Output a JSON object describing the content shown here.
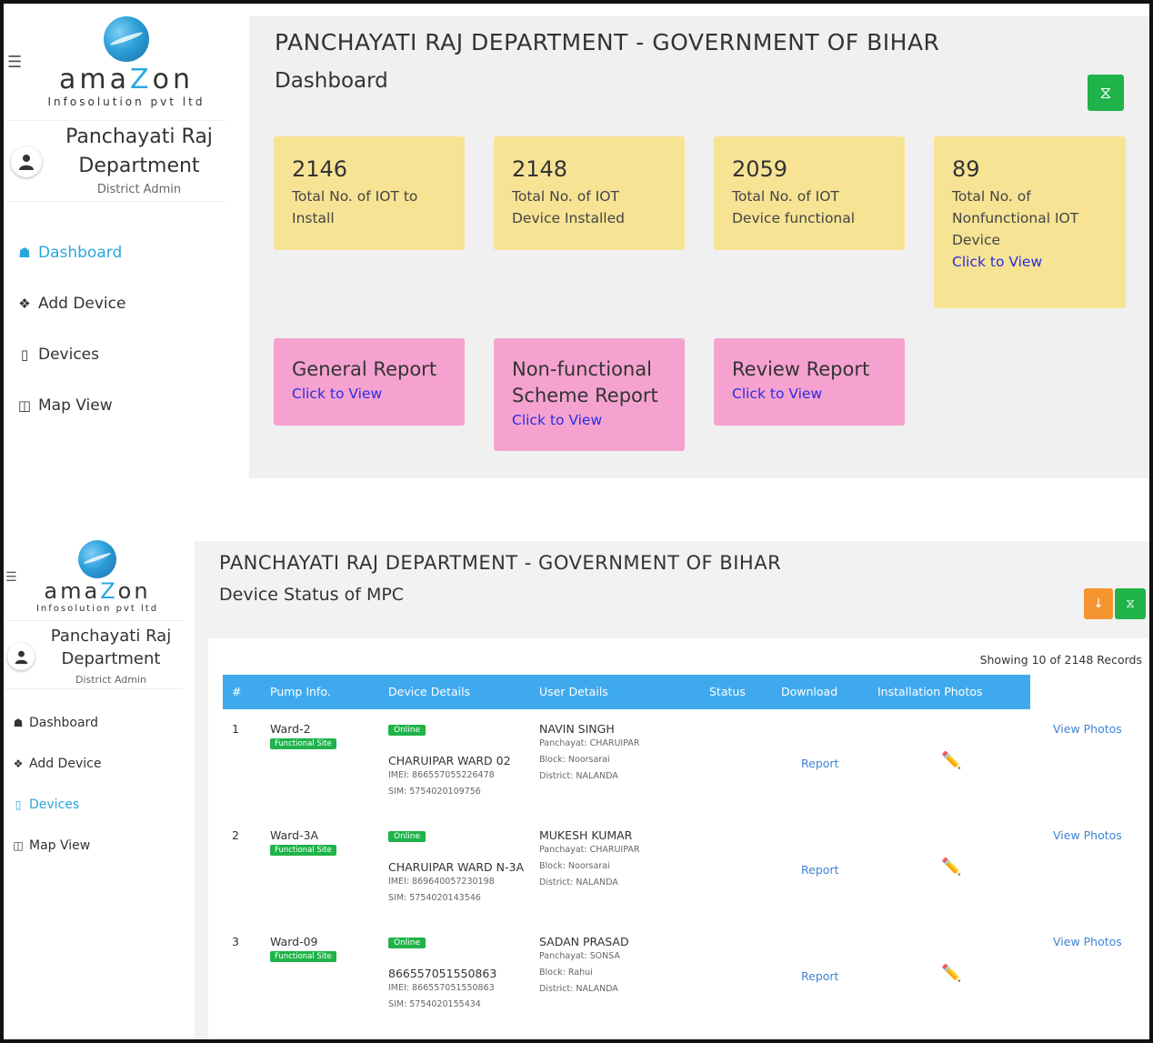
{
  "panel_a": {
    "logo": {
      "brand_left": "ama",
      "brand_z": "Z",
      "brand_right": "on",
      "tagline": "Infosolution pvt ltd"
    },
    "user": {
      "name_line1": "Panchayati Raj",
      "name_line2": "Department",
      "role": "District Admin"
    },
    "nav": [
      {
        "label": "Dashboard",
        "icon": "home-icon",
        "active": true
      },
      {
        "label": "Add Device",
        "icon": "grid-add-icon",
        "active": false
      },
      {
        "label": "Devices",
        "icon": "device-icon",
        "active": false
      },
      {
        "label": "Map View",
        "icon": "map-icon",
        "active": false
      }
    ],
    "header": {
      "title": "PANCHAYATI RAJ DEPARTMENT - GOVERNMENT OF BIHAR",
      "subtitle": "Dashboard"
    },
    "stat_cards": [
      {
        "value": "2146",
        "line1": "Total No. of IOT to",
        "line2": "Install"
      },
      {
        "value": "2148",
        "line1": "Total No. of IOT",
        "line2": "Device Installed"
      },
      {
        "value": "2059",
        "line1": "Total No. of IOT",
        "line2": "Device functional"
      },
      {
        "value": "89",
        "line1": "Total No. of",
        "line2": "Nonfunctional IOT",
        "line3": "Device",
        "link": "Click to View"
      }
    ],
    "report_cards": [
      {
        "title_line1": "General Report",
        "link": "Click to View"
      },
      {
        "title_line1": "Non-functional",
        "title_line2": "Scheme Report",
        "link": "Click to View"
      },
      {
        "title_line1": "Review Report",
        "link": "Click to View"
      }
    ]
  },
  "panel_b": {
    "logo": {
      "brand_left": "ama",
      "brand_z": "Z",
      "brand_right": "on",
      "tagline": "Infosolution pvt ltd"
    },
    "user": {
      "name_line1": "Panchayati Raj",
      "name_line2": "Department",
      "role": "District Admin"
    },
    "nav": [
      {
        "label": "Dashboard",
        "icon": "home-icon",
        "active": false
      },
      {
        "label": "Add Device",
        "icon": "grid-add-icon",
        "active": false
      },
      {
        "label": "Devices",
        "icon": "device-icon",
        "active": true
      },
      {
        "label": "Map View",
        "icon": "map-icon",
        "active": false
      }
    ],
    "header": {
      "title": "PANCHAYATI RAJ DEPARTMENT - GOVERNMENT OF BIHAR",
      "subtitle": "Device Status of MPC"
    },
    "showing": "Showing 10 of 2148 Records",
    "columns": [
      "#",
      "Pump Info.",
      "Device Details",
      "User Details",
      "Status",
      "Download",
      "Installation Photos"
    ],
    "rows": [
      {
        "num": "1",
        "ward": "Ward-2",
        "site_badge": "Functional Site",
        "online": "Online",
        "device_name": "CHARUIPAR WARD 02",
        "imei": "IMEI: 866557055226478",
        "sim": "SIM: 5754020109756",
        "user_name": "NAVIN SINGH",
        "panchayat": "Panchayat: CHARUIPAR",
        "block": "Block: Noorsarai",
        "district": "District: NALANDA",
        "report": "Report",
        "photos": "View Photos"
      },
      {
        "num": "2",
        "ward": "Ward-3A",
        "site_badge": "Functional Site",
        "online": "Online",
        "device_name": "CHARUIPAR WARD N-3A",
        "imei": "IMEI: 869640057230198",
        "sim": "SIM: 5754020143546",
        "user_name": "MUKESH KUMAR",
        "panchayat": "Panchayat: CHARUIPAR",
        "block": "Block: Noorsarai",
        "district": "District: NALANDA",
        "report": "Report",
        "photos": "View Photos"
      },
      {
        "num": "3",
        "ward": "Ward-09",
        "site_badge": "Functional Site",
        "online": "Online",
        "device_name": "866557051550863",
        "imei": "IMEI: 866557051550863",
        "sim": "SIM: 5754020155434",
        "user_name": "SADAN PRASAD",
        "panchayat": "Panchayat: SONSA",
        "block": "Block: Rahui",
        "district": "District: NALANDA",
        "report": "Report",
        "photos": "View Photos"
      }
    ]
  },
  "colors": {
    "accent_blue": "#2aa6de",
    "table_header": "#3fa9ee",
    "green": "#1fb34a",
    "orange": "#f49531",
    "card_yellow": "#f6e394",
    "card_pink": "#f5a2d0",
    "link_blue": "#2b2be0"
  }
}
